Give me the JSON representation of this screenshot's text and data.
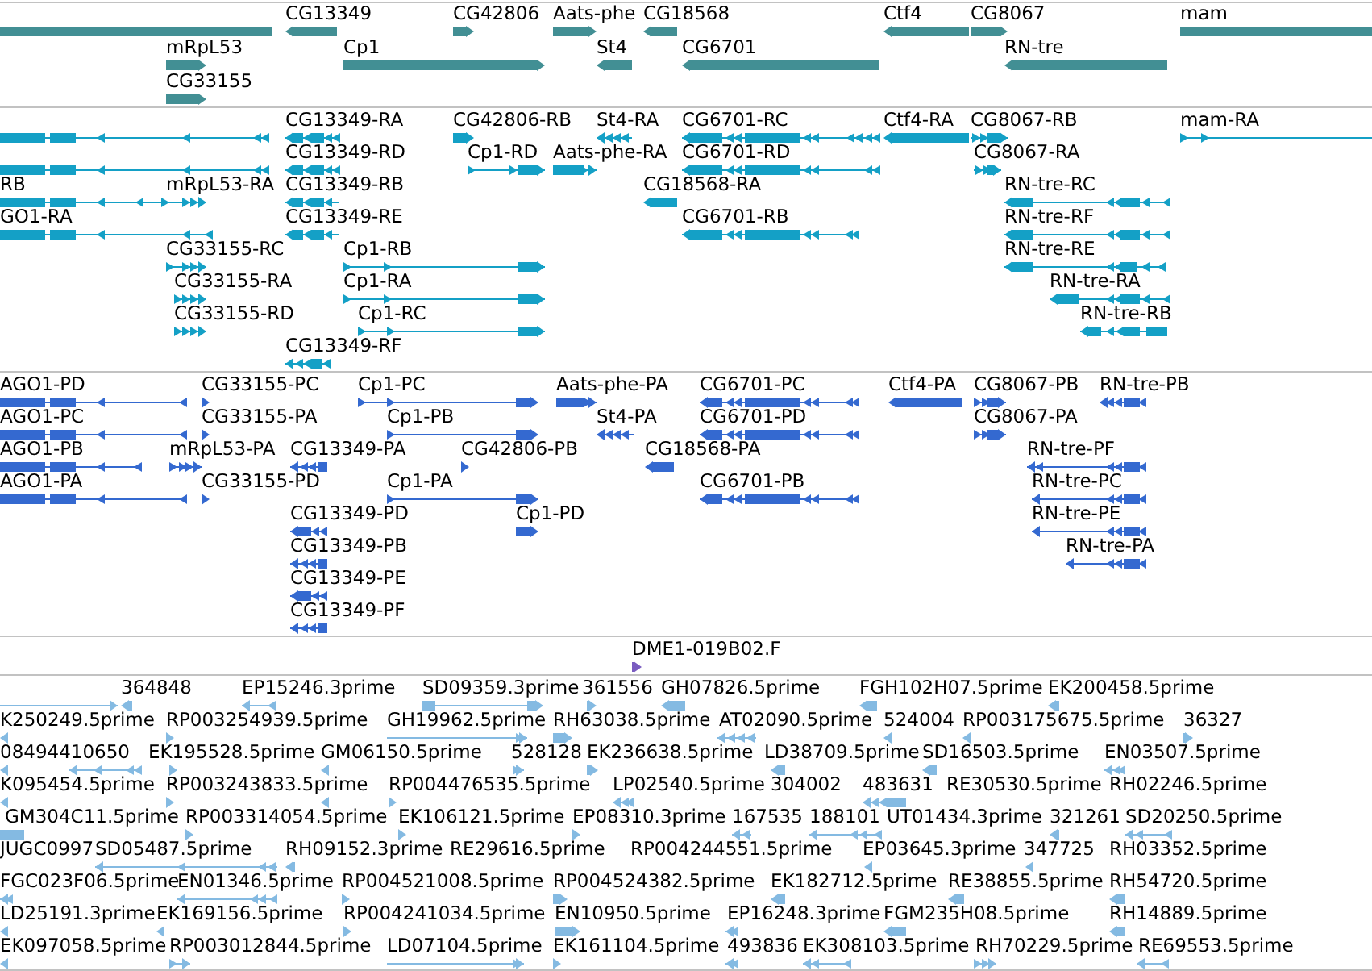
{
  "tracks": [
    {
      "kind": "gene",
      "rows": [
        {
          "features": [
            {
              "reverse": true
            },
            {
              "label": "CG13349",
              "reverse": true
            },
            {
              "label": "CG42806",
              "reverse": false
            },
            {
              "label": "Aats-phe",
              "reverse": false
            },
            {
              "label": "CG18568",
              "reverse": true
            },
            {
              "label": "Ctf4",
              "reverse": true
            },
            {
              "label": "CG8067",
              "reverse": false
            },
            {
              "label": "mam",
              "reverse": false
            }
          ]
        },
        {
          "features": [
            {
              "label": "mRpL53",
              "reverse": false
            },
            {
              "label": "Cp1",
              "reverse": false
            },
            {
              "label": "St4",
              "reverse": true
            },
            {
              "label": "CG6701",
              "reverse": true
            },
            {
              "label": "RN-tre",
              "reverse": true
            }
          ]
        },
        {
          "features": [
            {
              "label": "CG33155",
              "reverse": false
            }
          ]
        }
      ]
    },
    {
      "kind": "transcript",
      "rows": [
        {
          "features": [
            {
              "reverse": true
            },
            {
              "label": "CG13349-RA",
              "reverse": true
            },
            {
              "label": "CG42806-RB",
              "reverse": false
            },
            {
              "label": "St4-RA",
              "reverse": true
            },
            {
              "label": "CG6701-RC",
              "reverse": true
            },
            {
              "label": "Ctf4-RA",
              "reverse": true
            },
            {
              "label": "CG8067-RB",
              "reverse": false
            },
            {
              "label": "mam-RA",
              "reverse": false
            }
          ]
        },
        {
          "features": [
            {
              "reverse": true
            },
            {
              "label": "CG13349-RD",
              "reverse": true
            },
            {
              "label": "Cp1-RD",
              "reverse": false
            },
            {
              "label": "Aats-phe-RA",
              "reverse": false
            },
            {
              "label": "CG6701-RD",
              "reverse": true
            },
            {
              "label": "CG8067-RA",
              "reverse": false
            }
          ]
        },
        {
          "features": [
            {
              "label": "RB",
              "reverse": true
            },
            {
              "label": "mRpL53-RA",
              "reverse": false
            },
            {
              "label": "CG13349-RB",
              "reverse": true
            },
            {
              "label": "CG18568-RA",
              "reverse": true
            },
            {
              "label": "RN-tre-RC",
              "reverse": true
            }
          ]
        },
        {
          "features": [
            {
              "label": "GO1-RA",
              "reverse": true
            },
            {
              "label": "CG13349-RE",
              "reverse": true
            },
            {
              "label": "CG6701-RB",
              "reverse": true
            },
            {
              "label": "RN-tre-RF",
              "reverse": true
            }
          ]
        },
        {
          "features": [
            {
              "label": "CG33155-RC",
              "reverse": false
            },
            {
              "label": "Cp1-RB",
              "reverse": false
            },
            {
              "label": "RN-tre-RE",
              "reverse": true
            }
          ]
        },
        {
          "features": [
            {
              "label": "CG33155-RA",
              "reverse": false
            },
            {
              "label": "Cp1-RA",
              "reverse": false
            },
            {
              "label": "RN-tre-RA",
              "reverse": true
            }
          ]
        },
        {
          "features": [
            {
              "label": "CG33155-RD",
              "reverse": false
            },
            {
              "label": "Cp1-RC",
              "reverse": false
            },
            {
              "label": "RN-tre-RB",
              "reverse": true
            }
          ]
        },
        {
          "features": [
            {
              "label": "CG13349-RF",
              "reverse": true
            }
          ]
        }
      ]
    },
    {
      "kind": "protein",
      "rows": [
        {
          "features": [
            {
              "label": "AGO1-PD",
              "reverse": true
            },
            {
              "label": "CG33155-PC",
              "reverse": false
            },
            {
              "label": "Cp1-PC",
              "reverse": false
            },
            {
              "label": "Aats-phe-PA",
              "reverse": false
            },
            {
              "label": "CG6701-PC",
              "reverse": true
            },
            {
              "label": "Ctf4-PA",
              "reverse": true
            },
            {
              "label": "CG8067-PB",
              "reverse": false
            },
            {
              "label": "RN-tre-PB",
              "reverse": true
            }
          ]
        },
        {
          "features": [
            {
              "label": "AGO1-PC",
              "reverse": true
            },
            {
              "label": "CG33155-PA",
              "reverse": false
            },
            {
              "label": "Cp1-PB",
              "reverse": false
            },
            {
              "label": "St4-PA",
              "reverse": true
            },
            {
              "label": "CG6701-PD",
              "reverse": true
            },
            {
              "label": "CG8067-PA",
              "reverse": false
            }
          ]
        },
        {
          "features": [
            {
              "label": "AGO1-PB",
              "reverse": true
            },
            {
              "label": "mRpL53-PA",
              "reverse": false
            },
            {
              "label": "CG13349-PA",
              "reverse": true
            },
            {
              "label": "CG42806-PB",
              "reverse": false
            },
            {
              "label": "CG18568-PA",
              "reverse": true
            },
            {
              "label": "RN-tre-PF",
              "reverse": true
            }
          ]
        },
        {
          "features": [
            {
              "label": "AGO1-PA",
              "reverse": true
            },
            {
              "label": "CG33155-PD",
              "reverse": false
            },
            {
              "label": "Cp1-PA",
              "reverse": false
            },
            {
              "label": "CG6701-PB",
              "reverse": true
            },
            {
              "label": "RN-tre-PC",
              "reverse": true
            }
          ]
        },
        {
          "features": [
            {
              "label": "CG13349-PD",
              "reverse": true
            },
            {
              "label": "Cp1-PD",
              "reverse": false
            },
            {
              "label": "RN-tre-PE",
              "reverse": true
            }
          ]
        },
        {
          "features": [
            {
              "label": "CG13349-PB",
              "reverse": true
            },
            {
              "label": "RN-tre-PA",
              "reverse": true
            }
          ]
        },
        {
          "features": [
            {
              "label": "CG13349-PE",
              "reverse": true
            }
          ]
        },
        {
          "features": [
            {
              "label": "CG13349-PF",
              "reverse": true
            }
          ]
        }
      ]
    },
    {
      "kind": "clone",
      "rows": [
        {
          "features": [
            {
              "label": "DME1-019B02.F",
              "reverse": false
            }
          ]
        }
      ]
    },
    {
      "kind": "est",
      "rows": [
        {
          "features": [
            {
              "reverse": false
            },
            {
              "label": "364848",
              "reverse": true
            },
            {
              "label": "EP15246.3prime",
              "reverse": true
            },
            {
              "label": "SD09359.3prime",
              "reverse": false
            },
            {
              "label": "361556",
              "reverse": false
            },
            {
              "label": "GH07826.5prime",
              "reverse": true
            },
            {
              "label": "FGH102H07.5prime",
              "reverse": true
            },
            {
              "label": "EK200458.5prime",
              "reverse": true
            }
          ]
        },
        {
          "features": [
            {
              "label": "K250249.5prime",
              "reverse": true
            },
            {
              "label": "RP003254939.5prime",
              "reverse": false
            },
            {
              "label": "GH19962.5prime",
              "reverse": false
            },
            {
              "label": "RH63038.5prime",
              "reverse": false
            },
            {
              "label": "AT02090.5prime",
              "reverse": true
            },
            {
              "label": "524004",
              "reverse": true
            },
            {
              "label": "RP003175675.5prime",
              "reverse": true
            },
            {
              "label": "36327",
              "reverse": false
            }
          ]
        },
        {
          "features": [
            {
              "label": "08494410650",
              "reverse": true
            },
            {
              "reverse": true
            },
            {
              "label": "EK195528.5prime",
              "reverse": false
            },
            {
              "label": "GM06150.5prime",
              "reverse": true
            },
            {
              "label": "528128",
              "reverse": false
            },
            {
              "label": "EK236638.5prime",
              "reverse": false
            },
            {
              "label": "LD38709.5prime",
              "reverse": true
            },
            {
              "label": "SD16503.5prime",
              "reverse": true
            },
            {
              "label": "EN03507.5prime",
              "reverse": true
            }
          ]
        },
        {
          "features": [
            {
              "label": "K095454.5prime",
              "reverse": true
            },
            {
              "label": "RP003243833.5prime",
              "reverse": false
            },
            {
              "reverse": true
            },
            {
              "label": "RP004476535.5prime",
              "reverse": false
            },
            {
              "label": "LP02540.5prime",
              "reverse": true
            },
            {
              "label": "304002"
            },
            {
              "label": "483631",
              "reverse": true
            },
            {
              "label": "RE30530.5prime"
            },
            {
              "label": "RH02246.5prime"
            }
          ]
        },
        {
          "features": [
            {
              "label": "GM304C11.5prime",
              "reverse": true
            },
            {
              "label": "RP003314054.5prime",
              "reverse": false
            },
            {
              "label": "EK106121.5prime",
              "reverse": false
            },
            {
              "label": "EP08310.3prime",
              "reverse": false
            },
            {
              "label": "167535",
              "reverse": true
            },
            {
              "label": "188101",
              "reverse": true
            },
            {
              "label": "UT01434.3prime"
            },
            {
              "label": "321261",
              "reverse": true
            },
            {
              "label": "SD20250.5prime",
              "reverse": true
            }
          ]
        },
        {
          "features": [
            {
              "label": "JUGC0997"
            },
            {
              "label": "SD05487.5prime",
              "reverse": true
            },
            {
              "label": "RH09152.3prime",
              "reverse": true
            },
            {
              "label": "RE29616.5prime"
            },
            {
              "label": "RP004244551.5prime"
            },
            {
              "label": "EP03645.3prime",
              "reverse": true
            },
            {
              "label": "347725",
              "reverse": true
            },
            {
              "label": "RH03352.5prime"
            }
          ]
        },
        {
          "features": [
            {
              "label": "FGC023F06.5prime",
              "reverse": true
            },
            {
              "label": "EN01346.5prime",
              "reverse": true
            },
            {
              "label": "RP004521008.5prime",
              "reverse": false
            },
            {
              "label": "RP004524382.5prime",
              "reverse": false
            },
            {
              "label": "EK182712.5prime",
              "reverse": true
            },
            {
              "label": "RE38855.5prime",
              "reverse": true
            },
            {
              "label": "RH54720.5prime",
              "reverse": true
            }
          ]
        },
        {
          "features": [
            {
              "label": "LD25191.3prime",
              "reverse": true
            },
            {
              "label": "EK169156.5prime",
              "reverse": true
            },
            {
              "label": "RP004241034.5prime",
              "reverse": false
            },
            {
              "label": "EN10950.5prime",
              "reverse": false
            },
            {
              "label": "EP16248.3prime",
              "reverse": true
            },
            {
              "label": "FGM235H08.5prime",
              "reverse": true
            },
            {
              "label": "RH14889.5prime",
              "reverse": true
            }
          ]
        },
        {
          "features": [
            {
              "label": "EK097058.5prime",
              "reverse": true
            },
            {
              "label": "RP003012844.5prime",
              "reverse": false
            },
            {
              "label": "LD07104.5prime",
              "reverse": false
            },
            {
              "label": "EK161104.5prime",
              "reverse": false
            },
            {
              "label": "493836",
              "reverse": true
            },
            {
              "label": "EK308103.5prime",
              "reverse": true
            },
            {
              "label": "RH70229.5prime",
              "reverse": false
            },
            {
              "label": "RE69553.5prime",
              "reverse": true
            }
          ]
        }
      ]
    }
  ]
}
